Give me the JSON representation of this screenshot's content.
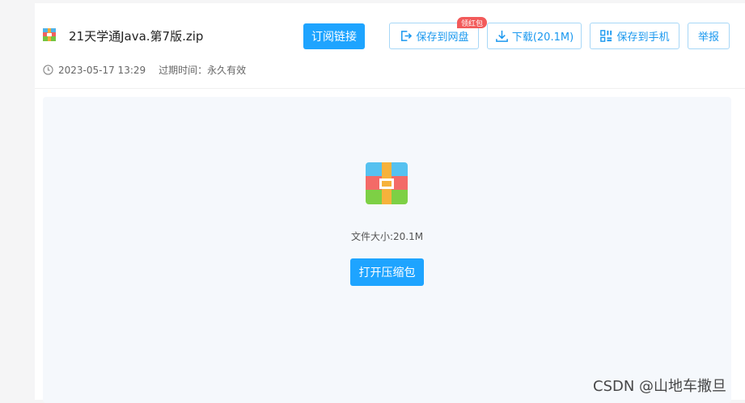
{
  "file": {
    "name": "21天学通Java.第7版.zip",
    "date": "2023-05-17 13:29",
    "expiry_label": "过期时间：",
    "expiry_value": "永久有效",
    "size_text": "文件大小:20.1M"
  },
  "actions": {
    "subscribe": "订阅链接",
    "save_to_cloud": "保存到网盘",
    "cloud_badge": "领红包",
    "download": "下载(20.1M)",
    "save_to_phone": "保存到手机",
    "report": "举报"
  },
  "preview": {
    "open_archive": "打开压缩包"
  },
  "watermark": "CSDN @山地车撒旦",
  "colors": {
    "primary": "#1ea4ff",
    "outline_border": "#a7d7f7",
    "badge": "#f25a5a",
    "preview_bg": "#f5f8fc"
  },
  "icons": {
    "file": "zip-archive-icon",
    "save": "save-to-cloud-icon",
    "download": "download-icon",
    "phone": "qr-code-icon",
    "time": "clock-icon"
  }
}
